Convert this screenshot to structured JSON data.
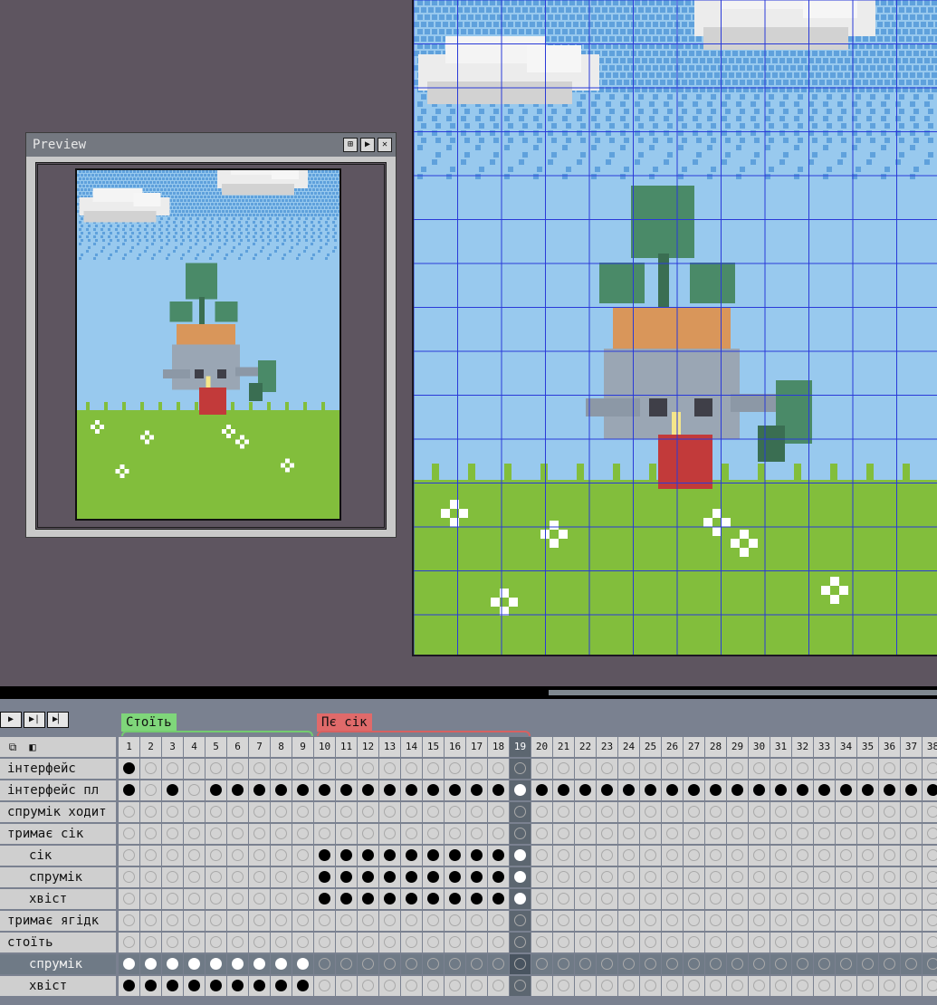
{
  "preview": {
    "title": "Preview",
    "buttons": [
      {
        "name": "fit-icon",
        "glyph": "⊞"
      },
      {
        "name": "play-icon",
        "glyph": "▶"
      },
      {
        "name": "close-icon",
        "glyph": "✕"
      }
    ]
  },
  "transport": [
    {
      "name": "play-button",
      "glyph": "▶"
    },
    {
      "name": "play-once-button",
      "glyph": "▶|"
    },
    {
      "name": "last-frame-button",
      "glyph": "▶▏"
    }
  ],
  "tags": [
    {
      "label": "Стоїть",
      "color": "#7fd67a"
    },
    {
      "label": "Пє сік",
      "color": "#e06a6a"
    }
  ],
  "timeline": {
    "frame_count_visible": 38,
    "current_frame": 19,
    "corner_icons": [
      "onion-skin-icon",
      "layers-icon"
    ],
    "layers": [
      {
        "label": "інтерфейс",
        "indent": 0,
        "selected": false,
        "cels": "F"
      },
      {
        "label": "інтерфейс пл",
        "indent": 0,
        "selected": false,
        "cels": "F.F.FFFFFFFFFFFFFFWFFFFFFFFFFFFFFFFFFF"
      },
      {
        "label": "спрумік ходит",
        "indent": 0,
        "selected": false,
        "cels": ""
      },
      {
        "label": "тримає сік",
        "indent": 0,
        "selected": false,
        "cels": ""
      },
      {
        "label": "сік",
        "indent": 1,
        "selected": false,
        "cels": ".........FFFFFFFFFW"
      },
      {
        "label": "спрумік",
        "indent": 1,
        "selected": false,
        "cels": ".........FFFFFFFFFW"
      },
      {
        "label": "хвіст",
        "indent": 1,
        "selected": false,
        "cels": ".........FFFFFFFFFW"
      },
      {
        "label": "тримає ягідк",
        "indent": 0,
        "selected": false,
        "cels": ""
      },
      {
        "label": "стоїть",
        "indent": 0,
        "selected": false,
        "cels": ""
      },
      {
        "label": "спрумік",
        "indent": 1,
        "selected": true,
        "cels": "WWWWWWWWW"
      },
      {
        "label": "хвіст",
        "indent": 1,
        "selected": false,
        "cels": "FFFFFFFFF"
      }
    ]
  }
}
